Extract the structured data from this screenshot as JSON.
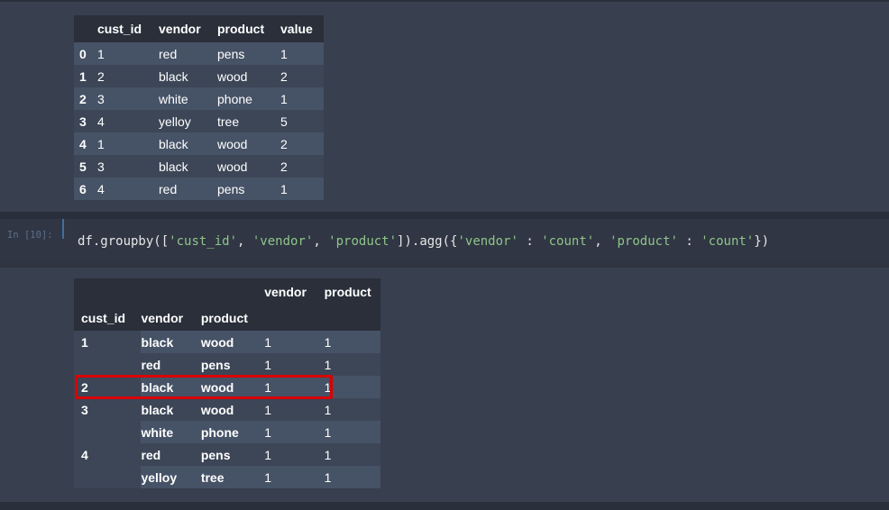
{
  "df1": {
    "columns": [
      "",
      "cust_id",
      "vendor",
      "product",
      "value"
    ],
    "rows": [
      [
        "0",
        "1",
        "red",
        "pens",
        "1"
      ],
      [
        "1",
        "2",
        "black",
        "wood",
        "2"
      ],
      [
        "2",
        "3",
        "white",
        "phone",
        "1"
      ],
      [
        "3",
        "4",
        "yelloy",
        "tree",
        "5"
      ],
      [
        "4",
        "1",
        "black",
        "wood",
        "2"
      ],
      [
        "5",
        "3",
        "black",
        "wood",
        "2"
      ],
      [
        "6",
        "4",
        "red",
        "pens",
        "1"
      ]
    ]
  },
  "cell": {
    "prompt": "In [10]:",
    "code_parts": [
      "df.groupby([",
      "'cust_id'",
      ", ",
      "'vendor'",
      ", ",
      "'product'",
      "]).agg({",
      "'vendor'",
      " : ",
      "'count'",
      ", ",
      "'product'",
      " : ",
      "'count'",
      "})"
    ]
  },
  "df2": {
    "value_columns": [
      "vendor",
      "product"
    ],
    "index_names": [
      "cust_id",
      "vendor",
      "product"
    ],
    "rows": [
      [
        "1",
        "black",
        "wood",
        "1",
        "1"
      ],
      [
        "",
        "red",
        "pens",
        "1",
        "1"
      ],
      [
        "2",
        "black",
        "wood",
        "1",
        "1"
      ],
      [
        "3",
        "black",
        "wood",
        "1",
        "1"
      ],
      [
        "",
        "white",
        "phone",
        "1",
        "1"
      ],
      [
        "4",
        "red",
        "pens",
        "1",
        "1"
      ],
      [
        "",
        "yelloy",
        "tree",
        "1",
        "1"
      ]
    ]
  },
  "colors": {
    "background": "#383f4e",
    "highlight": "#d90000",
    "string": "#8fc58a"
  }
}
